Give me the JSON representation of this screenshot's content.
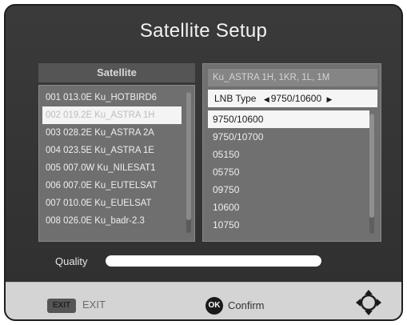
{
  "title": "Satellite Setup",
  "left_panel": {
    "header": "Satellite",
    "items": [
      "001 013.0E Ku_HOTBIRD6",
      "002 019.2E Ku_ASTRA 1H",
      "003 028.2E Ku_ASTRA 2A",
      "004 023.5E Ku_ASTRA 1E",
      "005 007.0W Ku_NILESAT1",
      "006 007.0E Ku_EUTELSAT",
      "007 010.0E Ku_EUELSAT",
      "008 026.0E Ku_badr-2.3"
    ],
    "selected_index": 1
  },
  "right_panel": {
    "header": "Ku_ASTRA 1H, 1KR, 1L, 1M",
    "lnb_label": "LNB Type",
    "lnb_left_arrow": "◀",
    "lnb_value": "9750/10600",
    "lnb_right_arrow": "▶",
    "lnb_options": [
      "9750/10600",
      "9750/10700",
      "05150",
      "05750",
      "09750",
      "10600",
      "10750"
    ],
    "highlight_index": 0
  },
  "quality": {
    "label": "Quality",
    "level_percent": 100
  },
  "footer": {
    "exit_key": "EXIT",
    "exit_label": "EXIT",
    "ok_key": "OK",
    "confirm_label": "Confirm"
  },
  "colors": {
    "background": "#333333",
    "panel": "#707070",
    "highlight": "#f5f5f5",
    "footer": "#d4d4d4"
  },
  "icons": {
    "navigate": "dpad-arrows-icon"
  }
}
